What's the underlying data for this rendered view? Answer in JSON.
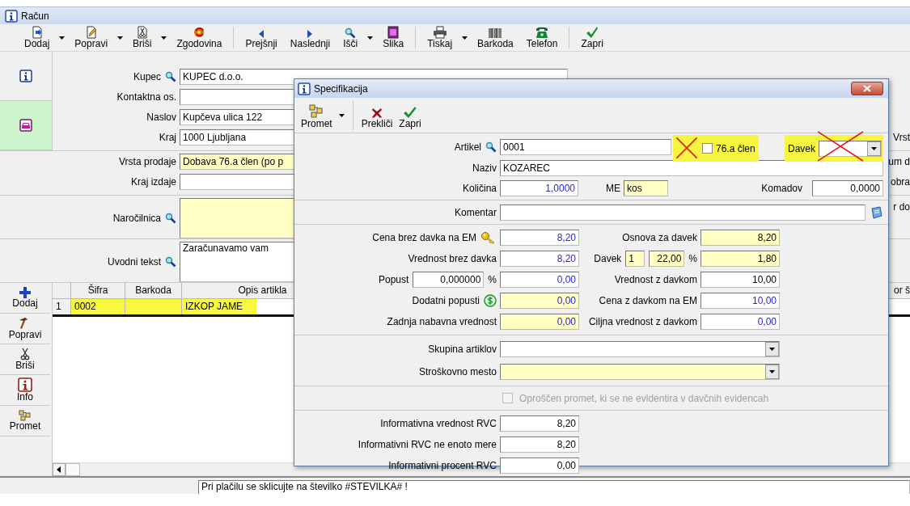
{
  "window": {
    "title": "Račun"
  },
  "toolbar": [
    [
      {
        "label": "Dodaj",
        "dropdown": true
      },
      {
        "label": "Popravi",
        "dropdown": true
      },
      {
        "label": "Briši",
        "dropdown": true
      },
      {
        "label": "Zgodovina"
      }
    ],
    [
      {
        "label": "Prejšnji"
      },
      {
        "label": "Naslednji"
      },
      {
        "label": "Išči",
        "dropdown": true
      },
      {
        "label": "Slika"
      }
    ],
    [
      {
        "label": "Tiskaj",
        "dropdown": true
      },
      {
        "label": "Barkoda"
      },
      {
        "label": "Telefon"
      }
    ],
    [
      {
        "label": "Zapri"
      }
    ]
  ],
  "side_tabs": [
    {
      "selected": false
    },
    {
      "selected": true
    }
  ],
  "form_sections": [
    [
      {
        "label": "Kupec",
        "lookup": true,
        "value": "KUPEC d.o.o.",
        "shaded": false,
        "kind": "line"
      },
      {
        "label": "Kontaktna os.",
        "shaded": false,
        "kind": "line"
      },
      {
        "label": "Naslov",
        "value": "Kupčeva ulica 122",
        "shaded": false,
        "kind": "line"
      },
      {
        "label": "Kraj",
        "value": "1000 Ljubljana",
        "shaded": false,
        "kind": "line",
        "trailing": "Vrst"
      }
    ],
    [
      {
        "label": "Vrsta prodaje",
        "value": "Dobava 76.a člen (po p",
        "shaded": true,
        "kind": "line",
        "trailing": "um d"
      },
      {
        "label": "Kraj izdaje",
        "shaded": false,
        "kind": "line",
        "trailing": "obra"
      }
    ],
    [
      {
        "label": "Naročilnica",
        "lookup": true,
        "shaded": true,
        "kind": "memo",
        "trailing": "r do"
      }
    ],
    [
      {
        "label": "Uvodni tekst",
        "lookup": true,
        "value": "Zaračunavamo vam",
        "shaded": false,
        "kind": "memo"
      }
    ]
  ],
  "grid": {
    "columns": [
      "Šifra",
      "Barkoda",
      "Opis artikla"
    ],
    "trailing": "or š",
    "rows": [
      {
        "number": "1",
        "code": "0002",
        "description": "IZKOP JAME",
        "highlighted": true
      }
    ]
  },
  "grid_actions": [
    "Dodaj",
    "Popravi",
    "Briši",
    "Info",
    "Promet"
  ],
  "closing_text": "Pri plačilu se sklicujte na številko #STEVILKA# !",
  "dialog": {
    "title": "Specifikacija",
    "toolbar": [
      {
        "label": "Promet",
        "dropdown": true
      },
      {
        "label": "Prekliči"
      },
      {
        "label": "Zapri"
      }
    ],
    "article": {
      "label": "Artikel",
      "value": "0001"
    },
    "vat_76a": {
      "label": "76.a člen",
      "checked": false,
      "crossed_out": true
    },
    "tax": {
      "label": "Davek",
      "crossed_out": true
    },
    "name": {
      "label": "Naziv",
      "value": "KOZAREC"
    },
    "quantity": {
      "label": "Količina",
      "value": "1,0000"
    },
    "unit": {
      "label": "ME",
      "value": "kos"
    },
    "pieces": {
      "label": "Komadov",
      "value": "0,0000"
    },
    "comment": {
      "label": "Komentar"
    },
    "pricing_rows": [
      {
        "label": "Cena brez davka na EM",
        "value": "8,20",
        "editable": true,
        "shaded": false,
        "right_label": "Osnova za davek",
        "right_value": "8,20",
        "right_editable": false,
        "right_shaded": true
      },
      {
        "label": "Vrednost brez davka",
        "value": "8,20",
        "editable": true,
        "shaded": false,
        "right_label": "Davek",
        "tax_code": "1",
        "tax_rate": "22,00",
        "rate_unit": "%",
        "right_value": "1,80",
        "right_editable": false,
        "right_shaded": true
      },
      {
        "label": "Popust",
        "discount": "0,000000",
        "discount_unit": "%",
        "value": "0,00",
        "editable": true,
        "shaded": false,
        "right_label": "Vrednost z davkom",
        "right_value": "10,00",
        "right_editable": false,
        "right_shaded": false
      },
      {
        "label": "Dodatni popusti",
        "value": "0,00",
        "editable": true,
        "shaded": true,
        "right_label": "Cena z davkom na EM",
        "right_value": "10,00",
        "right_editable": true,
        "right_shaded": false
      },
      {
        "label": "Zadnja nabavna vrednost",
        "value": "0,00",
        "editable": true,
        "shaded": true,
        "right_label": "Ciljna vrednost z davkom",
        "right_value": "0,00",
        "right_editable": true,
        "right_shaded": false
      }
    ],
    "combos": [
      {
        "label": "Skupina artiklov",
        "shaded": false
      },
      {
        "label": "Stroškovno mesto",
        "shaded": true
      }
    ],
    "exempt": {
      "label": "Oproščen promet, ki se ne evidentira v davčnih evidencah",
      "checked": false,
      "disabled": true
    },
    "info_rows": [
      {
        "label": "Informativna vrednost RVC",
        "value": "8,20"
      },
      {
        "label": "Informativni RVC ne enoto mere",
        "value": "8,20"
      },
      {
        "label": "Informativni procent RVC",
        "value": "0,00"
      }
    ]
  }
}
